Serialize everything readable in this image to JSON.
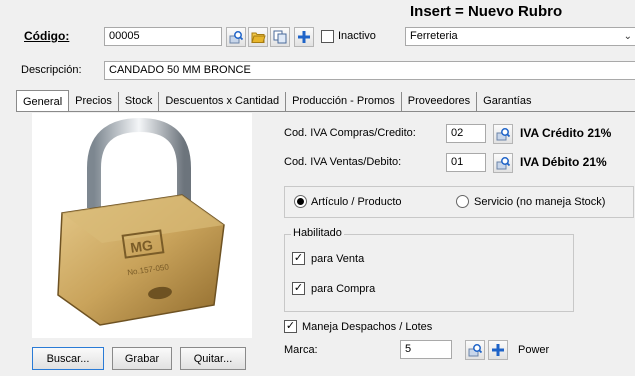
{
  "header": {
    "mode_title": "Insert = Nuevo Rubro",
    "codigo_label": "Código:",
    "codigo_value": "00005",
    "inactivo_label": "Inactivo",
    "rubro_value": "Ferreteria",
    "descripcion_label": "Descripción:",
    "descripcion_value": "CANDADO 50 MM BRONCE"
  },
  "tabs": [
    {
      "label": "General"
    },
    {
      "label": "Precios"
    },
    {
      "label": "Stock"
    },
    {
      "label": "Descuentos x Cantidad"
    },
    {
      "label": "Producción - Promos"
    },
    {
      "label": "Proveedores"
    },
    {
      "label": "Garantías"
    }
  ],
  "general": {
    "iva_compras_label": "Cod. IVA Compras/Credito:",
    "iva_compras_value": "02",
    "iva_compras_desc": "IVA Crédito 21%",
    "iva_ventas_label": "Cod. IVA Ventas/Debito:",
    "iva_ventas_value": "01",
    "iva_ventas_desc": "IVA Débito 21%",
    "tipo_articulo": "Artículo / Producto",
    "tipo_servicio": "Servicio (no maneja Stock)",
    "habilitado_label": "Habilitado",
    "para_venta": "para Venta",
    "para_compra": "para Compra",
    "maneja_despachos": "Maneja Despachos / Lotes",
    "marca_label": "Marca:",
    "marca_value": "5",
    "marca_desc": "Power",
    "padlock_brand": "MG",
    "padlock_model": "No.157-050"
  },
  "buttons": {
    "buscar": "Buscar...",
    "grabar": "Grabar",
    "quitar": "Quitar..."
  },
  "colors": {
    "icon_blue": "#1e63c8",
    "icon_folder": "#e7b52b",
    "focus_border": "#2a7bd6"
  }
}
